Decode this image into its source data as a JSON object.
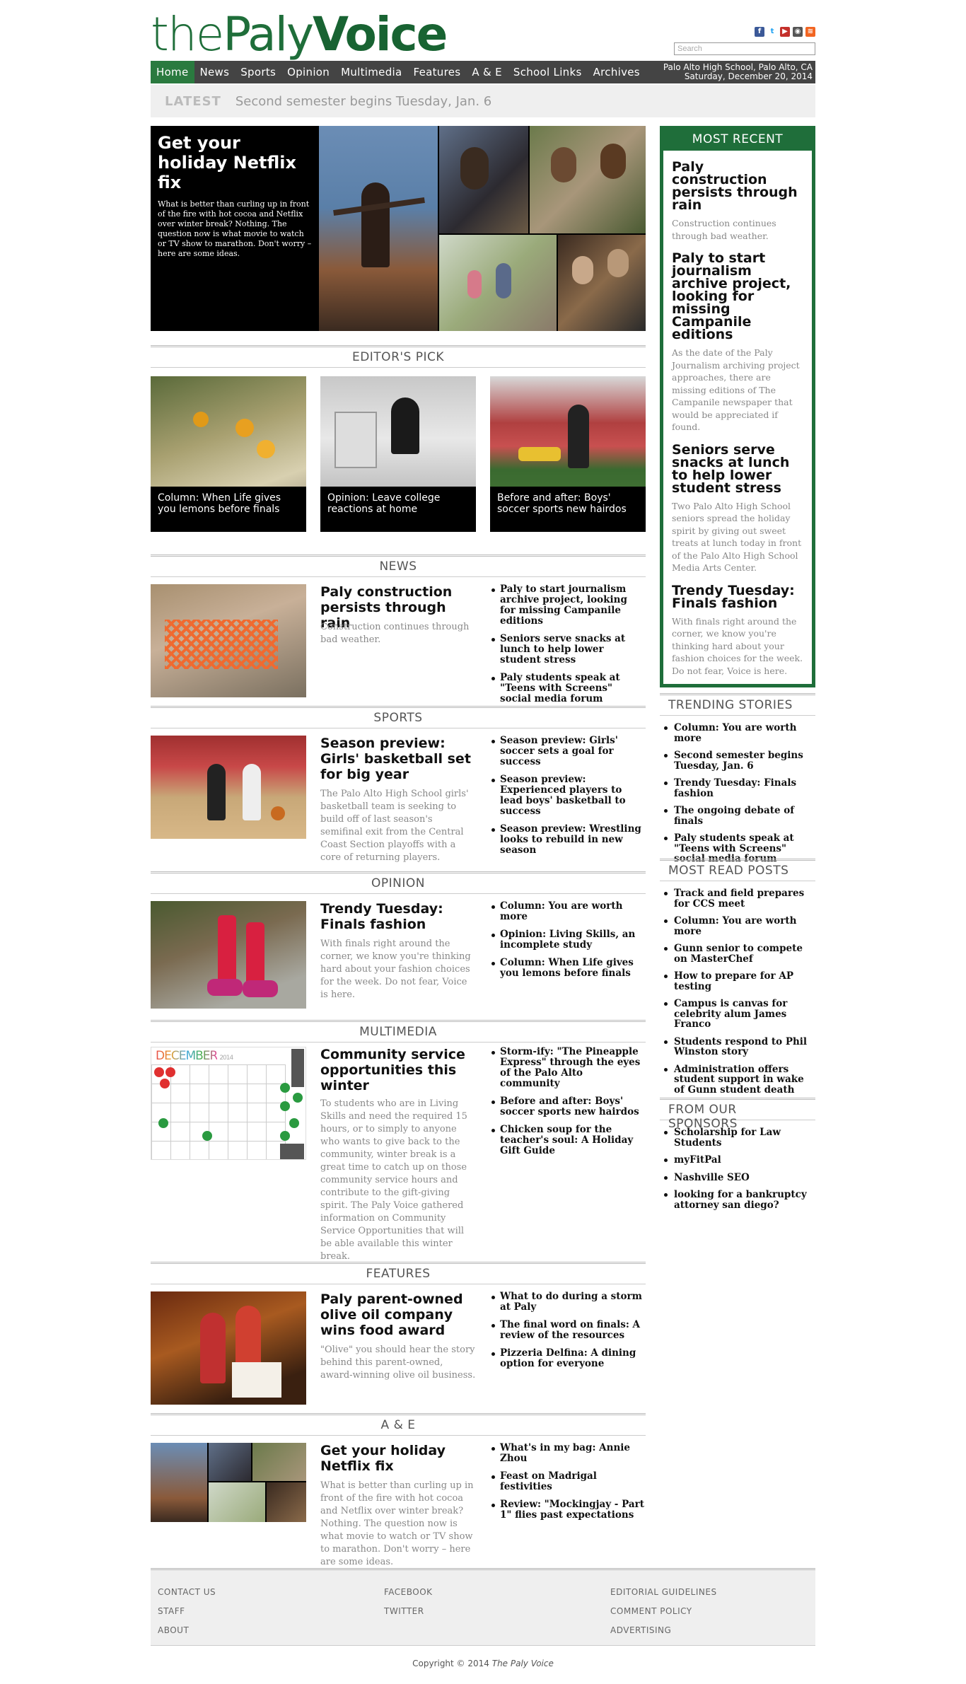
{
  "site": {
    "logo_the": "the",
    "logo_paly": "Paly",
    "logo_voice": "Voice",
    "search_placeholder": "Search",
    "location": "Palo Alto High School, Palo Alto, CA",
    "date": "Saturday, December 20, 2014"
  },
  "nav": [
    "Home",
    "News",
    "Sports",
    "Opinion",
    "Multimedia",
    "Features",
    "A & E",
    "School Links",
    "Archives"
  ],
  "latest": {
    "tag": "LATEST",
    "text": "Second semester begins Tuesday, Jan. 6"
  },
  "hero": {
    "title": "Get your holiday Netflix fix",
    "excerpt": "What is better than curling up in front of the fire with hot cocoa and Netflix over winter break? Nothing. The question now is what movie to watch or TV show to marathon. Don't worry – here are some ideas."
  },
  "sections": {
    "editors_pick": "EDITOR'S PICK",
    "news": "NEWS",
    "sports": "SPORTS",
    "opinion": "OPINION",
    "multimedia": "MULTIMEDIA",
    "features": "FEATURES",
    "ae": "A & E"
  },
  "picks": [
    "Column: When Life gives you lemons before finals",
    "Opinion: Leave college reactions at home",
    "Before and after: Boys' soccer sports new hairdos"
  ],
  "news": {
    "title": "Paly construction persists through rain",
    "excerpt": "Construction continues through bad weather.",
    "links": [
      "Paly to start journalism archive project, looking for missing Campanile editions",
      "Seniors serve snacks at lunch to help lower student stress",
      "Paly students speak at \"Teens with Screens\" social media forum"
    ]
  },
  "sports": {
    "title": "Season preview: Girls' basketball set for big year",
    "excerpt": "The Palo Alto High School girls' basketball team is seeking to build off of last season's semifinal exit from the Central Coast Section playoffs with a core of returning players.",
    "links": [
      "Season preview: Girls' soccer sets a goal for success",
      "Season preview: Experienced players to lead boys' basketball to success",
      "Season preview: Wrestling looks to rebuild in new season"
    ]
  },
  "opinion": {
    "title": "Trendy Tuesday: Finals fashion",
    "excerpt": "With finals right around the corner, we know you're thinking hard about your fashion choices for the week. Do not fear, Voice is here.",
    "links": [
      "Column: You are worth more",
      "Opinion: Living Skills, an incomplete study",
      "Column: When Life gives you lemons before finals"
    ]
  },
  "multimedia": {
    "title": "Community service opportunities this winter",
    "excerpt": "To students who are in Living Skills and need the required 15 hours, or to simply to anyone who wants to give back to the community, winter break is a great time to catch up on those community service hours and contribute to the gift-giving spirit. The Paly Voice gathered information on Community Service Opportunities that will be able available this winter break.",
    "links": [
      "Storm-ify: \"The Pineapple Express\" through the eyes of the Palo Alto community",
      "Before and after: Boys' soccer sports new hairdos",
      "Chicken soup for the teacher's soul: A Holiday Gift Guide"
    ],
    "calendar_month": "DECEMBER",
    "calendar_year": "2014"
  },
  "features": {
    "title": "Paly parent-owned olive oil company wins food award",
    "excerpt": "\"Olive\" you should hear the story behind this parent-owned, award-winning olive oil business.",
    "links": [
      "What to do during a storm at Paly",
      "The final word on finals: A review of the resources",
      "Pizzeria Delfina: A dining option for everyone"
    ]
  },
  "ae": {
    "title": "Get your holiday Netflix fix",
    "excerpt": "What is better than curling up in front of the fire with hot cocoa and Netflix over winter break? Nothing. The question now is what movie to watch or TV show to marathon. Don't worry – here are some ideas.",
    "links": [
      "What's in my bag: Annie Zhou",
      "Feast on Madrigal festivities",
      "Review: \"Mockingjay - Part 1\" flies past expectations"
    ]
  },
  "most_recent": {
    "heading": "MOST RECENT",
    "items": [
      {
        "title": "Paly construction persists through rain",
        "excerpt": "Construction continues through bad weather."
      },
      {
        "title": "Paly to start journalism archive project, looking for missing Campanile editions",
        "excerpt": "As the date of the Paly Journalism archiving project approaches, there are missing editions of The Campanile newspaper that would be appreciated if found."
      },
      {
        "title": "Seniors serve snacks at lunch to help lower student stress",
        "excerpt": "Two Palo Alto High School seniors spread the holiday spirit by giving out sweet treats at lunch today in front of the Palo Alto High School Media Arts Center."
      },
      {
        "title": "Trendy Tuesday: Finals fashion",
        "excerpt": "With finals right around the corner, we know you're thinking hard about your fashion choices for the week. Do not fear, Voice is here."
      }
    ]
  },
  "trending": {
    "heading": "TRENDING STORIES",
    "items": [
      "Column: You are worth more",
      "Second semester begins Tuesday, Jan. 6",
      "Trendy Tuesday: Finals fashion",
      "The ongoing debate of finals",
      "Paly students speak at \"Teens with Screens\" social media forum"
    ]
  },
  "most_read": {
    "heading": "MOST READ POSTS",
    "items": [
      "Track and field prepares for CCS meet",
      "Column: You are worth more",
      "Gunn senior to compete on MasterChef",
      "How to prepare for AP testing",
      "Campus is canvas for celebrity alum James Franco",
      "Students respond to Phil Winston story",
      "Administration offers student support in wake of Gunn student death"
    ]
  },
  "sponsors": {
    "heading": "FROM OUR SPONSORS",
    "items": [
      "Scholarship for Law Students",
      "myFitPal",
      "Nashville SEO",
      "looking for a bankruptcy attorney san diego?"
    ]
  },
  "footer": {
    "col1": [
      "CONTACT US",
      "STAFF",
      "ABOUT"
    ],
    "col2": [
      "FACEBOOK",
      "TWITTER"
    ],
    "col3": [
      "EDITORIAL GUIDELINES",
      "COMMENT POLICY",
      "ADVERTISING"
    ],
    "copyright": "Copyright © 2014 ",
    "copyright_name": "The Paly Voice"
  }
}
